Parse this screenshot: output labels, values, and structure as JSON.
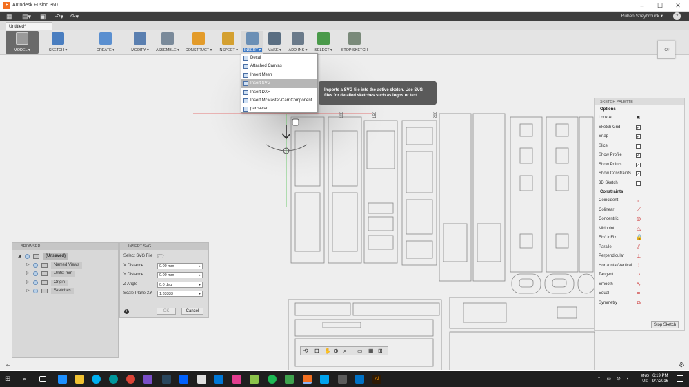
{
  "window": {
    "title": "Autodesk Fusion 360",
    "app_icon": "F"
  },
  "account": {
    "user": "Ruben Speybrouck ▾",
    "help": "?"
  },
  "document_tab": {
    "label": "Untitled*"
  },
  "workspace": {
    "label": "MODEL ▾"
  },
  "toolbar": [
    {
      "label": "SKETCH ▾",
      "icon": "sketch-icon",
      "color": "#4a7ec0"
    },
    {
      "label": "CREATE ▾",
      "icon": "create-icon",
      "color": "#5a8fd0"
    },
    {
      "label": "MODIFY ▾",
      "icon": "modify-icon",
      "color": "#5a7fb0"
    },
    {
      "label": "ASSEMBLE ▾",
      "icon": "assemble-icon",
      "color": "#7a8a9a"
    },
    {
      "label": "CONSTRUCT ▾",
      "icon": "construct-icon",
      "color": "#e39b2a"
    },
    {
      "label": "INSPECT ▾",
      "icon": "inspect-icon",
      "color": "#d4a030"
    },
    {
      "label": "INSERT ▾",
      "icon": "insert-icon",
      "color": "#6b8fb5"
    },
    {
      "label": "MAKE ▾",
      "icon": "make-icon",
      "color": "#5a6e82"
    },
    {
      "label": "ADD-INS ▾",
      "icon": "addins-icon",
      "color": "#6a7a8a"
    },
    {
      "label": "SELECT ▾",
      "icon": "select-icon",
      "color": "#4a9a4a"
    },
    {
      "label": "STOP SKETCH",
      "icon": "stop-sketch-icon",
      "color": "#7a8a7a"
    }
  ],
  "viewcube": {
    "label": "TOP"
  },
  "insert_menu": [
    {
      "label": "Decal",
      "selected": false
    },
    {
      "label": "Attached Canvas",
      "selected": false
    },
    {
      "label": "Insert Mesh",
      "selected": false
    },
    {
      "label": "Insert SVG",
      "selected": true
    },
    {
      "label": "Insert DXF",
      "selected": false
    },
    {
      "label": "Insert McMaster-Carr Component",
      "selected": false
    },
    {
      "label": "parts4cad",
      "selected": false
    }
  ],
  "tooltip": {
    "text": "Imports a SVG file into the active sketch. Use SVG files for detailed sketches such as logos or text."
  },
  "sketch_palette": {
    "title": "SKETCH PALETTE",
    "options_header": "Options",
    "options": [
      {
        "label": "Look At",
        "checked": null
      },
      {
        "label": "Sketch Grid",
        "checked": true
      },
      {
        "label": "Snap",
        "checked": true
      },
      {
        "label": "Slice",
        "checked": false
      },
      {
        "label": "Show Profile",
        "checked": true
      },
      {
        "label": "Show Points",
        "checked": true
      },
      {
        "label": "Show Constraints",
        "checked": true
      },
      {
        "label": "3D Sketch",
        "checked": false
      }
    ],
    "constraints_header": "Constraints",
    "constraints": [
      {
        "label": "Coincident",
        "glyph": "⌞"
      },
      {
        "label": "Colinear",
        "glyph": "⟋"
      },
      {
        "label": "Concentric",
        "glyph": "◎"
      },
      {
        "label": "Midpoint",
        "glyph": "△"
      },
      {
        "label": "Fix/UnFix",
        "glyph": "🔒"
      },
      {
        "label": "Parallel",
        "glyph": "⫽"
      },
      {
        "label": "Perpendicular",
        "glyph": "⟂"
      },
      {
        "label": "Horizontal/Vertical",
        "glyph": "⫶"
      },
      {
        "label": "Tangent",
        "glyph": "◔"
      },
      {
        "label": "Smooth",
        "glyph": "∿"
      },
      {
        "label": "Equal",
        "glyph": "="
      },
      {
        "label": "Symmetry",
        "glyph": "⧉"
      }
    ],
    "stop_button": "Stop Sketch"
  },
  "browser": {
    "title": "BROWSER",
    "items": [
      {
        "label": "(Unsaved)",
        "level": 0
      },
      {
        "label": "Named Views",
        "level": 1
      },
      {
        "label": "Units: mm",
        "level": 1
      },
      {
        "label": "Origin",
        "level": 1
      },
      {
        "label": "Sketches",
        "level": 1
      }
    ]
  },
  "insert_svg_dialog": {
    "title": "INSERT SVG",
    "select_label": "Select SVG File",
    "fields": [
      {
        "label": "X Distance",
        "value": "0.00 mm"
      },
      {
        "label": "Y Distance",
        "value": "0.00 mm"
      },
      {
        "label": "Z Angle",
        "value": "0.0 deg"
      },
      {
        "label": "Scale Plane XY",
        "value": "1.33333"
      }
    ],
    "ok": "OK",
    "cancel": "Cancel"
  },
  "canvas_labels": {
    "dim1": "100",
    "dim2": "150",
    "dim3": "200"
  },
  "taskbar": {
    "lang_line1": "ENG",
    "lang_line2": "US",
    "time": "6:19 PM",
    "date": "9/7/2016"
  }
}
